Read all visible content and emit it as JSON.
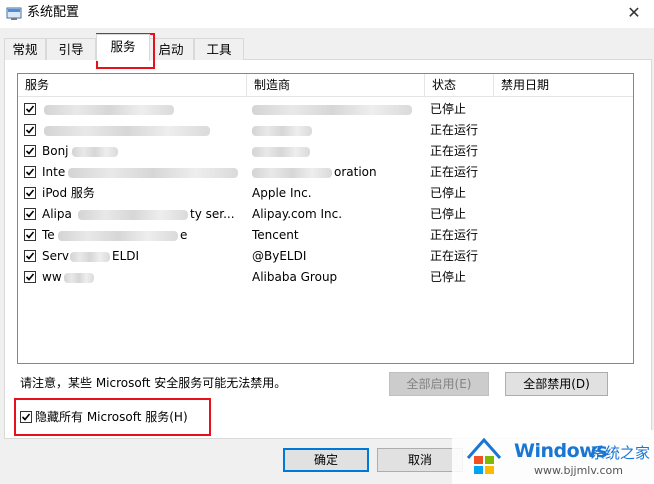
{
  "window": {
    "title": "系统配置",
    "close_glyph": "✕"
  },
  "tabs": [
    {
      "label": "常规"
    },
    {
      "label": "引导"
    },
    {
      "label": "服务",
      "active": true
    },
    {
      "label": "启动"
    },
    {
      "label": "工具"
    }
  ],
  "list": {
    "headers": [
      "服务",
      "制造商",
      "状态",
      "禁用日期"
    ],
    "rows": [
      {
        "service": "",
        "maker": "",
        "status": "已停止",
        "checked": true
      },
      {
        "service": "",
        "maker": "",
        "status": "正在运行",
        "checked": true
      },
      {
        "service": "Bonj",
        "maker": "",
        "status": "正在运行",
        "checked": true
      },
      {
        "service": "Inte",
        "maker": "oration",
        "status": "正在运行",
        "checked": true
      },
      {
        "service": "iPod 服务",
        "maker": "Apple Inc.",
        "status": "已停止",
        "checked": true
      },
      {
        "service": "Alipa",
        "maker": "Alipay.com Inc.",
        "status": "已停止",
        "checked": true,
        "service_tail": "ty ser..."
      },
      {
        "service": "Te",
        "maker": "Tencent",
        "status": "正在运行",
        "checked": true,
        "service_tail": "e"
      },
      {
        "service": "Serv",
        "maker": "@ByELDI",
        "status": "正在运行",
        "checked": true,
        "service_tail": "ELDI"
      },
      {
        "service": "ww",
        "maker": "Alibaba Group",
        "status": "已停止",
        "checked": true
      }
    ]
  },
  "note": "请注意，某些 Microsoft 安全服务可能无法禁用。",
  "buttons": {
    "enable_all": "全部启用(E)",
    "disable_all": "全部禁用(D)",
    "ok": "确定",
    "cancel": "取消"
  },
  "hide_ms": {
    "label": "隐藏所有 Microsoft 服务(H)",
    "checked": true
  },
  "watermark": {
    "brand": "Windows",
    "cn": "系统之家",
    "url": "www.bjjmlv.com"
  },
  "colors": {
    "highlight": "#e8101a",
    "accent": "#0078d7",
    "brand": "#1976d2"
  }
}
